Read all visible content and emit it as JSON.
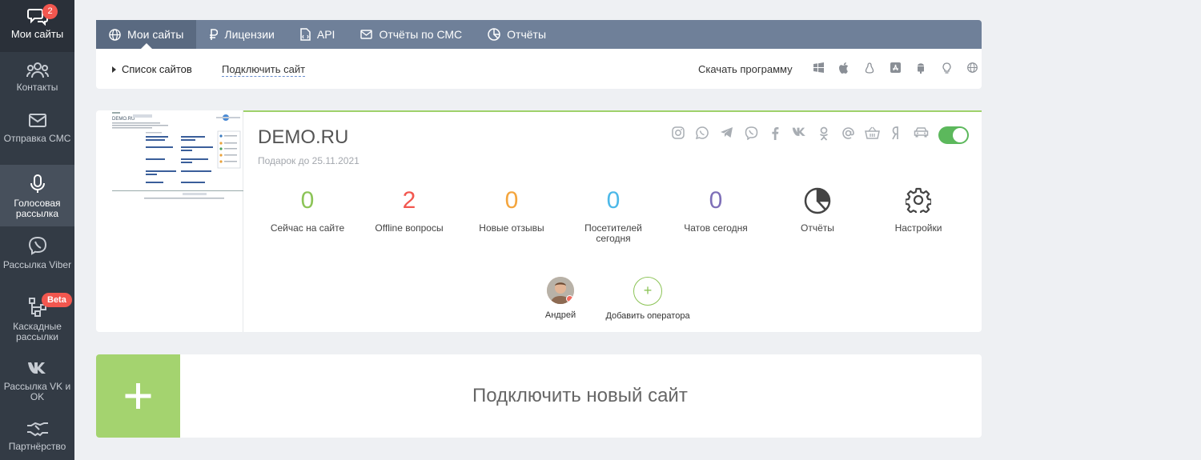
{
  "sidebar": {
    "badge_count": "2",
    "beta_label": "Beta",
    "items": [
      {
        "label": "Мои сайты",
        "icon": "chat-icon"
      },
      {
        "label": "Контакты",
        "icon": "users-icon"
      },
      {
        "label": "Отправка СМС",
        "icon": "envelope-icon"
      },
      {
        "label": "Голосовая рассылка",
        "icon": "microphone-icon"
      },
      {
        "label": "Рассылка Viber",
        "icon": "viber-icon"
      },
      {
        "label": "Каскадные рассылки",
        "icon": "cascade-icon"
      },
      {
        "label": "Рассылка VK и OK",
        "icon": "vk-icon"
      },
      {
        "label": "Партнёрство",
        "icon": "handshake-icon"
      }
    ]
  },
  "tabs": [
    {
      "label": "Мои сайты",
      "icon": "globe-icon"
    },
    {
      "label": "Лицензии",
      "icon": "ruble-icon"
    },
    {
      "label": "API",
      "icon": "document-icon"
    },
    {
      "label": "Отчёты по СМС",
      "icon": "envelope-icon"
    },
    {
      "label": "Отчёты",
      "icon": "pie-chart-icon"
    }
  ],
  "subbar": {
    "list_label": "Список сайтов",
    "connect_label": "Подключить сайт",
    "download_label": "Скачать программу",
    "platforms": [
      "windows-icon",
      "apple-icon",
      "linux-icon",
      "appstore-icon",
      "android-icon",
      "bulb-icon",
      "web-icon"
    ]
  },
  "site": {
    "name": "DEMO.RU",
    "gift": "Подарок до 25.11.2021",
    "enabled": true,
    "channels": [
      "instagram-icon",
      "whatsapp-icon",
      "telegram-icon",
      "viber-icon",
      "facebook-icon",
      "vk-icon",
      "odnoklassniki-icon",
      "email-icon",
      "basket-icon",
      "yandex-icon",
      "car-icon"
    ],
    "stats": [
      {
        "value": "0",
        "label": "Сейчас на сайте",
        "color": "#8cc457"
      },
      {
        "value": "2",
        "label": "Offline вопросы",
        "color": "#f2574f"
      },
      {
        "value": "0",
        "label": "Новые отзывы",
        "color": "#f4a53d"
      },
      {
        "value": "0",
        "label": "Посетителей сегодня",
        "color": "#4cb8e8"
      },
      {
        "value": "0",
        "label": "Чатов сегодня",
        "color": "#7e6fb8"
      }
    ],
    "reports_label": "Отчёты",
    "settings_label": "Настройки",
    "operator_name": "Андрей",
    "add_operator_label": "Добавить оператора"
  },
  "new_site_label": "Подключить новый сайт",
  "colors": {
    "sidebar": "#333b45",
    "tabbar": "#6f8099",
    "accent_green": "#a4d36f",
    "toggle": "#5cb85c"
  }
}
